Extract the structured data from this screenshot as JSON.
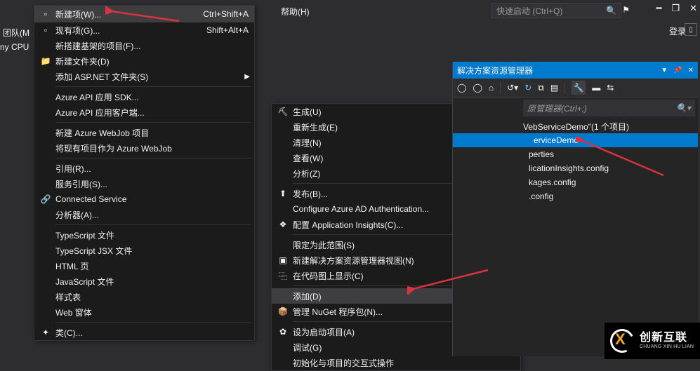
{
  "titlebar": {
    "help_menu": "帮助(H)",
    "quick_launch_placeholder": "快速启动 (Ctrl+Q)",
    "login": "登录"
  },
  "left_panel": {
    "team": "团队(M",
    "cpu": "ny CPU"
  },
  "left_menu": {
    "new_item": {
      "label": "新建项(W)...",
      "shortcut": "Ctrl+Shift+A"
    },
    "existing_item": {
      "label": "现有项(G)...",
      "shortcut": "Shift+Alt+A"
    },
    "scaffold_item": "新搭建基架的项目(F)...",
    "new_folder": "新建文件夹(D)",
    "add_aspnet_folder": "添加 ASP.NET 文件夹(S)",
    "azure_api_sdk": "Azure API 应用 SDK...",
    "azure_api_client": "Azure API 应用客户端...",
    "new_azure_webjob": "新建 Azure WebJob 项目",
    "existing_as_webjob": "将现有项目作为 Azure WebJob",
    "reference": "引用(R)...",
    "service_reference": "服务引用(S)...",
    "connected_service": "Connected Service",
    "analyzer": "分析器(A)...",
    "ts_file": "TypeScript 文件",
    "ts_jsx_file": "TypeScript JSX 文件",
    "html_page": "HTML 页",
    "js_file": "JavaScript 文件",
    "stylesheet": "样式表",
    "web_form": "Web 窗体",
    "class": "类(C)..."
  },
  "right_menu": {
    "build": "生成(U)",
    "rebuild": "重新生成(E)",
    "clean": "清理(N)",
    "view": "查看(W)",
    "analyze": "分析(Z)",
    "publish": "发布(B)...",
    "azure_ad": "Configure Azure AD Authentication...",
    "app_insights": "配置 Application Insights(C)...",
    "scope": "限定为此范围(S)",
    "new_sol_view": "新建解决方案资源管理器视图(N)",
    "show_codemap": "在代码图上显示(C)",
    "add": "添加(D)",
    "manage_nuget": "管理 NuGet 程序包(N)...",
    "set_startup": "设为启动项目(A)",
    "debug": "调试(G)",
    "init_interactive": "初始化与项目的交互式操作"
  },
  "solution_explorer": {
    "title": "解决方案资源管理器",
    "search_placeholder": "原管理器(Ctrl+;)",
    "solution_line": "VebServiceDemo\"(1 个项目)",
    "project": "erviceDemo",
    "properties": "perties",
    "app_insights_config": "licationInsights.config",
    "packages_config": "kages.config",
    "web_config": ".config"
  },
  "brand": {
    "name": "创新互联",
    "sub": "CHUANG XIN HU LIAN"
  }
}
